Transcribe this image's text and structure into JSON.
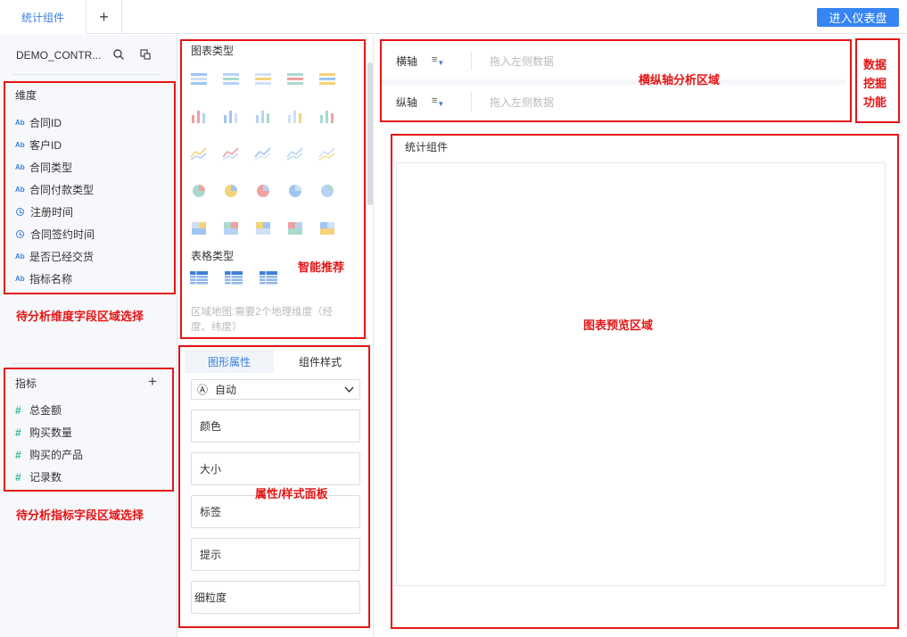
{
  "tabs": {
    "active": "统计组件",
    "add": "+"
  },
  "header": {
    "enter_dashboard": "进入仪表盘"
  },
  "datasource": {
    "name": "DEMO_CONTR..."
  },
  "dimensions": {
    "title": "维度",
    "items": [
      {
        "type": "text",
        "label": "合同ID"
      },
      {
        "type": "text",
        "label": "客户ID"
      },
      {
        "type": "text",
        "label": "合同类型"
      },
      {
        "type": "text",
        "label": "合同付款类型"
      },
      {
        "type": "time",
        "label": "注册时间"
      },
      {
        "type": "time",
        "label": "合同签约时间"
      },
      {
        "type": "text",
        "label": "是否已经交货"
      },
      {
        "type": "text",
        "label": "指标名称"
      }
    ]
  },
  "metrics": {
    "title": "指标",
    "add": "+",
    "items": [
      {
        "label": "总金额"
      },
      {
        "label": "购买数量"
      },
      {
        "label": "购买的产品"
      },
      {
        "label": "记录数"
      }
    ]
  },
  "icons": {
    "ab": "Ab",
    "hash": "#"
  },
  "chart_types": {
    "title": "图表类型",
    "table_title": "表格类型",
    "hint": "区域地图:需要2个地理维度（经度、纬度）"
  },
  "properties": {
    "tab_shape": "图形属性",
    "tab_style": "组件样式",
    "mode": "自动",
    "mode_icon": "Ⓐ",
    "boxes": [
      "颜色",
      "大小",
      "标签",
      "提示",
      "细粒度"
    ]
  },
  "axis": {
    "x_label": "横轴",
    "y_label": "纵轴",
    "placeholder": "拖入左侧数据"
  },
  "preview": {
    "title": "统计组件"
  },
  "annotations": {
    "dim_area": "待分析维度字段区域选择",
    "metric_area": "待分析指标字段区域选择",
    "smart": "智能推荐",
    "axis_area": "横纵轴分析区域",
    "mining": "数据挖掘功能",
    "mining_lines": [
      "数据",
      "挖掘",
      "功能"
    ],
    "prop_panel": "属性/样式面板",
    "preview_area": "图表预览区域"
  },
  "colors": {
    "accent": "#3a7ee0",
    "annotation": "#e51515",
    "metric": "#2bb7a1"
  }
}
